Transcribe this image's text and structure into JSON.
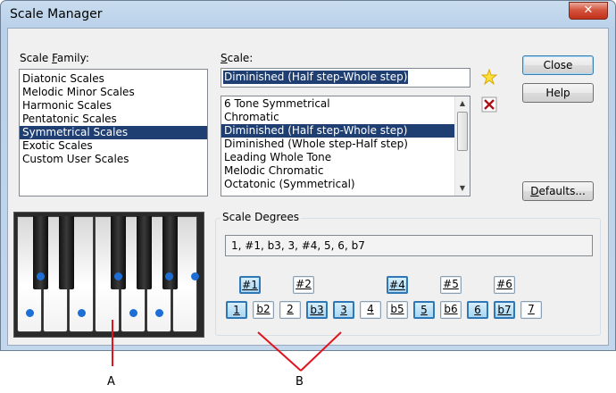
{
  "window": {
    "title": "Scale Manager"
  },
  "scale_family": {
    "label": "Scale Family:",
    "items": [
      "Diatonic Scales",
      "Melodic Minor Scales",
      "Harmonic Scales",
      "Pentatonic Scales",
      "Symmetrical Scales",
      "Exotic Scales",
      "Custom User Scales"
    ],
    "selected": "Symmetrical Scales"
  },
  "scale": {
    "label": "Scale:",
    "value": "Diminished (Half step-Whole step)",
    "items": [
      "6 Tone Symmetrical",
      "Chromatic",
      "Diminished (Half step-Whole step)",
      "Diminished (Whole step-Half step)",
      "Leading Whole Tone",
      "Melodic Chromatic",
      "Octatonic (Symmetrical)"
    ],
    "selected": "Diminished (Half step-Whole step)"
  },
  "buttons": {
    "close": "Close",
    "help": "Help",
    "defaults": "Defaults..."
  },
  "icons": {
    "new": "new-star-icon",
    "delete": "delete-x-icon",
    "close_window": "window-close-icon"
  },
  "scale_degrees": {
    "label": "Scale Degrees",
    "summary": "1, #1, b3, 3, #4, 5, 6, b7",
    "top_row": [
      {
        "label": "#1",
        "on": true
      },
      {
        "label": "#2",
        "on": false
      },
      {
        "label": "#4",
        "on": true
      },
      {
        "label": "#5",
        "on": false
      },
      {
        "label": "#6",
        "on": false
      }
    ],
    "bottom_row": [
      {
        "label": "1",
        "on": true
      },
      {
        "label": "b2",
        "on": false
      },
      {
        "label": "2",
        "on": false
      },
      {
        "label": "b3",
        "on": true
      },
      {
        "label": "3",
        "on": true
      },
      {
        "label": "4",
        "on": false
      },
      {
        "label": "b5",
        "on": false
      },
      {
        "label": "5",
        "on": true
      },
      {
        "label": "b6",
        "on": false
      },
      {
        "label": "6",
        "on": true
      },
      {
        "label": "b7",
        "on": true
      },
      {
        "label": "7",
        "on": false
      }
    ]
  },
  "callouts": {
    "a": "A",
    "b": "B"
  },
  "colors": {
    "selection": "#1f3f73",
    "accent_blue": "#1d6fd6",
    "degree_on_border": "#2f78b5",
    "callout_line": "#e0141e"
  }
}
